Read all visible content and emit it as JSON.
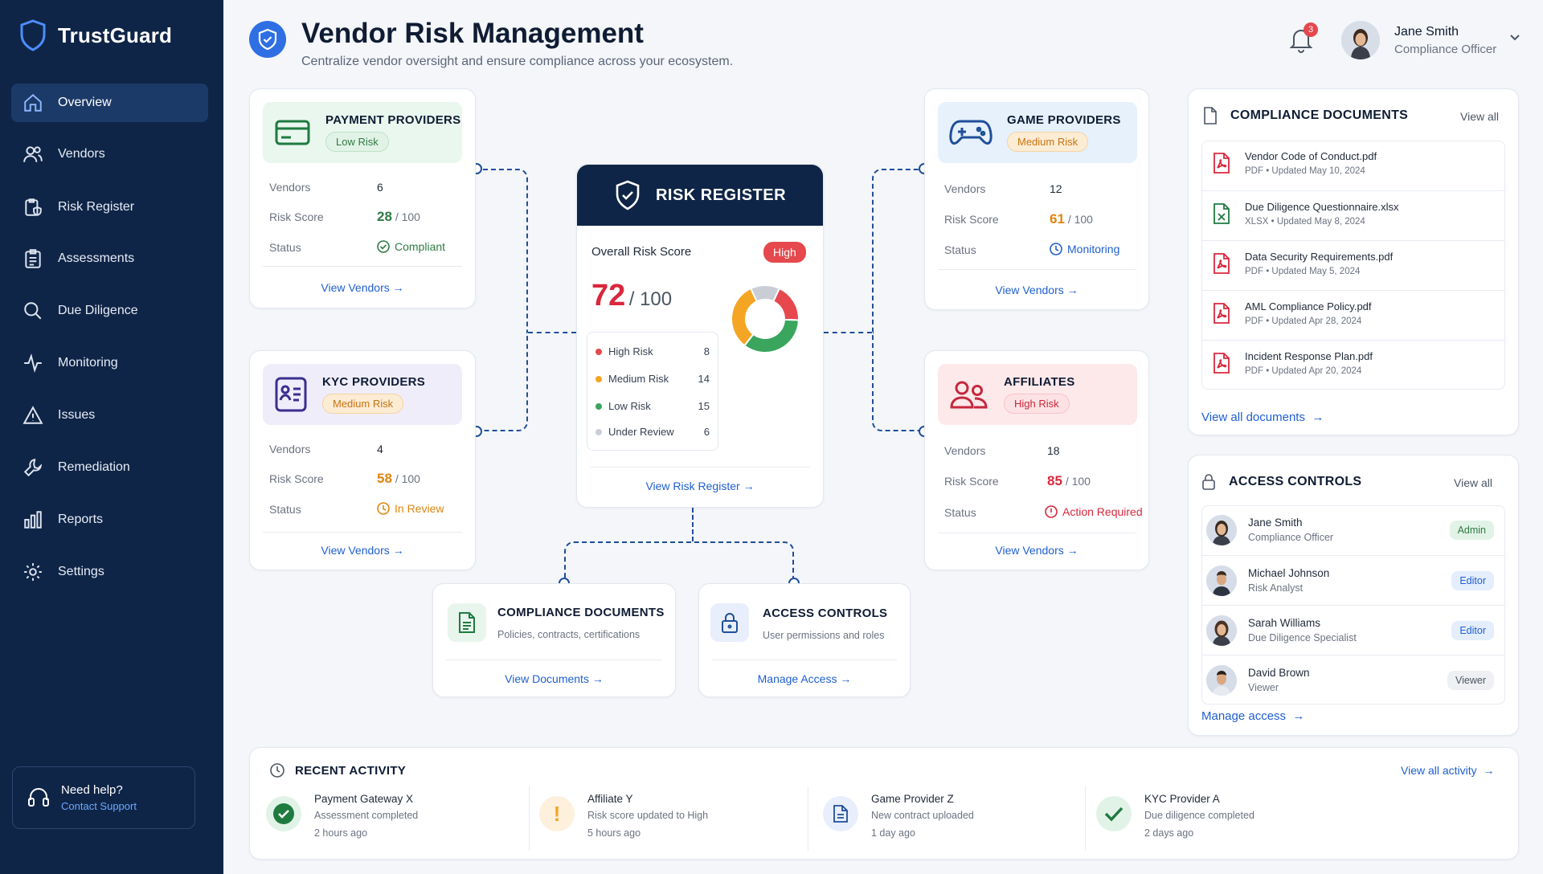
{
  "app": {
    "name": "TrustGuard"
  },
  "sidebar": {
    "items": [
      {
        "label": "Overview",
        "icon": "home-icon",
        "active": true
      },
      {
        "label": "Vendors",
        "icon": "users-icon"
      },
      {
        "label": "Risk Register",
        "icon": "clipboard-shield-icon"
      },
      {
        "label": "Assessments",
        "icon": "clipboard-list-icon"
      },
      {
        "label": "Due Diligence",
        "icon": "search-icon"
      },
      {
        "label": "Monitoring",
        "icon": "activity-icon"
      },
      {
        "label": "Issues",
        "icon": "warning-icon"
      },
      {
        "label": "Remediation",
        "icon": "wrench-icon"
      },
      {
        "label": "Reports",
        "icon": "bar-chart-icon"
      },
      {
        "label": "Settings",
        "icon": "gear-icon"
      }
    ],
    "help": {
      "title": "Need help?",
      "link": "Contact Support"
    }
  },
  "header": {
    "title": "Vendor Risk Management",
    "subtitle": "Centralize vendor oversight and ensure compliance across your ecosystem.",
    "notifications": "3",
    "user": {
      "name": "Jane Smith",
      "role": "Compliance Officer"
    }
  },
  "vendor_cards": {
    "payment": {
      "title": "PAYMENT PROVIDERS",
      "risk": "Low Risk",
      "vendors_label": "Vendors",
      "vendors": "6",
      "score_label": "Risk Score",
      "score": "28",
      "score_max": "/ 100",
      "status_label": "Status",
      "status": "Compliant",
      "link": "View Vendors"
    },
    "kyc": {
      "title": "KYC PROVIDERS",
      "risk": "Medium Risk",
      "vendors_label": "Vendors",
      "vendors": "4",
      "score_label": "Risk Score",
      "score": "58",
      "score_max": "/ 100",
      "status_label": "Status",
      "status": "In Review",
      "link": "View Vendors"
    },
    "game": {
      "title": "GAME PROVIDERS",
      "risk": "Medium Risk",
      "vendors_label": "Vendors",
      "vendors": "12",
      "score_label": "Risk Score",
      "score": "61",
      "score_max": "/ 100",
      "status_label": "Status",
      "status": "Monitoring",
      "link": "View Vendors"
    },
    "affiliates": {
      "title": "AFFILIATES",
      "risk": "High Risk",
      "vendors_label": "Vendors",
      "vendors": "18",
      "score_label": "Risk Score",
      "score": "85",
      "score_max": "/ 100",
      "status_label": "Status",
      "status": "Action Required",
      "link": "View Vendors"
    }
  },
  "risk_register": {
    "title": "RISK REGISTER",
    "overall_label": "Overall Risk Score",
    "level": "High",
    "score": "72",
    "score_max": "/ 100",
    "breakdown": [
      {
        "label": "High Risk",
        "value": 8,
        "color": "#e5484d"
      },
      {
        "label": "Medium Risk",
        "value": 14,
        "color": "#f5a524"
      },
      {
        "label": "Low Risk",
        "value": 15,
        "color": "#3aa55d"
      },
      {
        "label": "Under Review",
        "value": 6,
        "color": "#c9ced6"
      }
    ],
    "link": "View Risk Register"
  },
  "lower_cards": {
    "compliance": {
      "title": "COMPLIANCE DOCUMENTS",
      "desc": "Policies, contracts, certifications",
      "link": "View Documents"
    },
    "access": {
      "title": "ACCESS CONTROLS",
      "desc": "User permissions and roles",
      "link": "Manage Access"
    }
  },
  "compliance_panel": {
    "title": "COMPLIANCE DOCUMENTS",
    "view_all": "View all",
    "docs": [
      {
        "name": "Vendor Code of Conduct.pdf",
        "type": "PDF",
        "updated": "Updated May 10, 2024",
        "icon": "pdf-file-icon"
      },
      {
        "name": "Due Diligence Questionnaire.xlsx",
        "type": "XLSX",
        "updated": "Updated May 8, 2024",
        "icon": "excel-file-icon"
      },
      {
        "name": "Data Security Requirements.pdf",
        "type": "PDF",
        "updated": "Updated May 5, 2024",
        "icon": "pdf-file-icon"
      },
      {
        "name": "AML Compliance Policy.pdf",
        "type": "PDF",
        "updated": "Updated Apr 28, 2024",
        "icon": "pdf-file-icon"
      },
      {
        "name": "Incident Response Plan.pdf",
        "type": "PDF",
        "updated": "Updated Apr 20, 2024",
        "icon": "pdf-file-icon"
      }
    ],
    "footer_link": "View all documents"
  },
  "access_panel": {
    "title": "ACCESS CONTROLS",
    "view_all": "View all",
    "users": [
      {
        "name": "Jane Smith",
        "role": "Compliance Officer",
        "perm": "Admin",
        "color": "#2f7a44",
        "bg": "#e1f3e6"
      },
      {
        "name": "Michael Johnson",
        "role": "Risk Analyst",
        "perm": "Editor",
        "color": "#1f5fd1",
        "bg": "#e4eefc"
      },
      {
        "name": "Sarah Williams",
        "role": "Due Diligence Specialist",
        "perm": "Editor",
        "color": "#1f5fd1",
        "bg": "#e4eefc"
      },
      {
        "name": "David Brown",
        "role": "Viewer",
        "perm": "Viewer",
        "color": "#4b5563",
        "bg": "#eef0f3"
      }
    ],
    "footer_link": "Manage access"
  },
  "activity": {
    "title": "RECENT ACTIVITY",
    "view_all": "View all activity",
    "items": [
      {
        "title": "Payment Gateway X",
        "desc": "Assessment completed",
        "when": "2 hours ago",
        "icon": "check-circle-icon"
      },
      {
        "title": "Affiliate Y",
        "desc": "Risk score updated to High",
        "when": "5 hours ago",
        "icon": "exclamation-icon"
      },
      {
        "title": "Game Provider Z",
        "desc": "New contract uploaded",
        "when": "1 day ago",
        "icon": "document-icon"
      },
      {
        "title": "KYC Provider A",
        "desc": "Due diligence completed",
        "when": "2 days ago",
        "icon": "check-icon"
      }
    ]
  }
}
